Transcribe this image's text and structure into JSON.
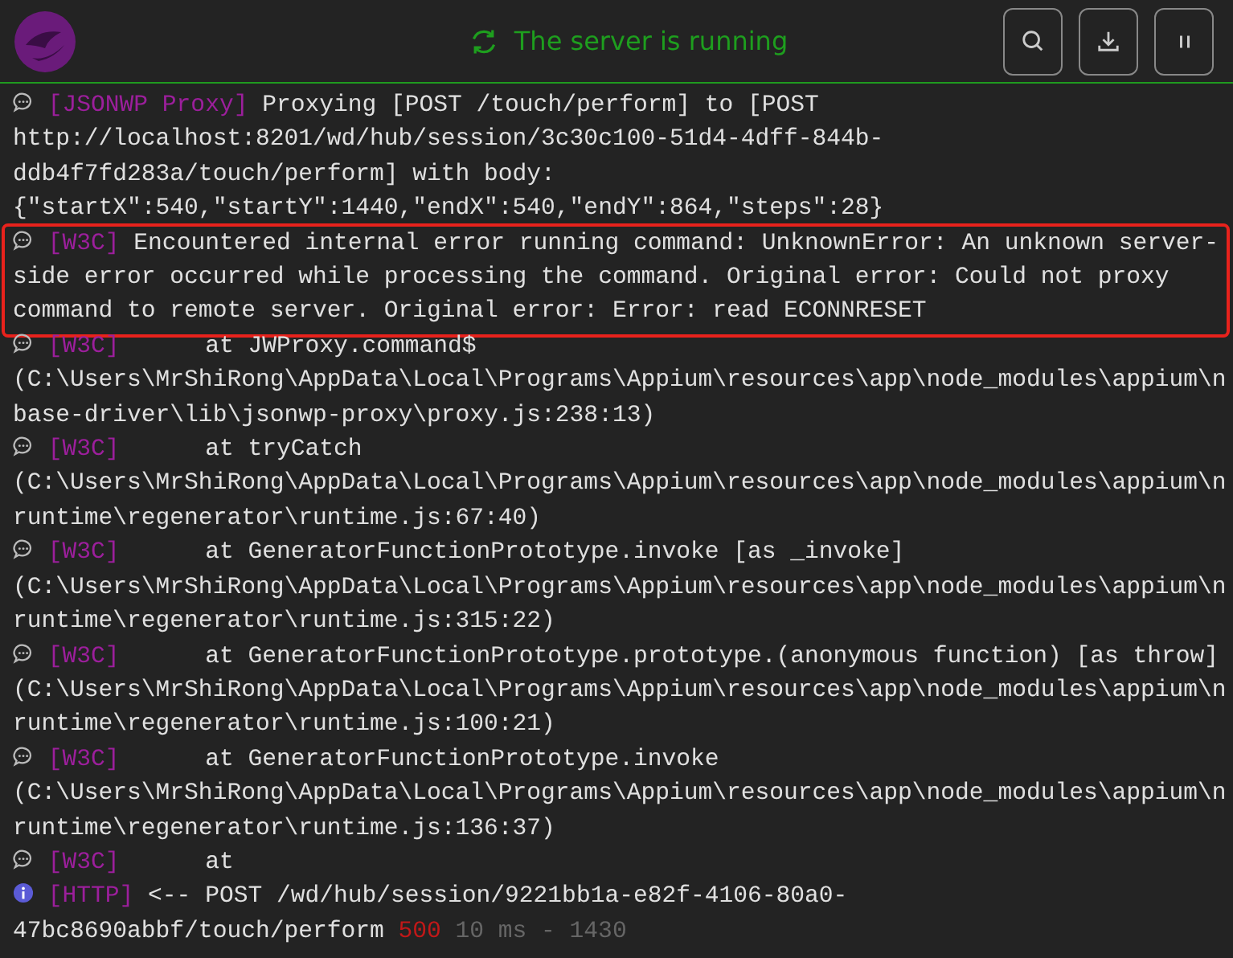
{
  "header": {
    "status": "The server is running",
    "running": true,
    "buttons": [
      {
        "kind": "search"
      },
      {
        "kind": "download"
      },
      {
        "kind": "pause"
      }
    ]
  },
  "log": [
    {
      "kind": "log",
      "tag": "[JSONWP Proxy]",
      "message": "Proxying [POST /touch/perform] to [POST http://localhost:8201/wd/hub/session/3c30c100-51d4-4dff-844b-ddb4f7fd283a/touch/perform] with body: {\"startX\":540,\"startY\":1440,\"endX\":540,\"endY\":864,\"steps\":28}",
      "highlighted": false
    },
    {
      "kind": "log",
      "tag": "[W3C]",
      "message": "Encountered internal error running command: UnknownError: An unknown server-side error occurred while processing the command. Original error: Could not proxy command to remote server. Original error: Error: read ECONNRESET",
      "highlighted": true
    },
    {
      "kind": "log",
      "tag": "[W3C]",
      "message": "     at JWProxy.command$ (C:\\Users\\MrShiRong\\AppData\\Local\\Programs\\Appium\\resources\\app\\node_modules\\appium\\nbase-driver\\lib\\jsonwp-proxy\\proxy.js:238:13)",
      "highlighted": false
    },
    {
      "kind": "log",
      "tag": "[W3C]",
      "message": "     at tryCatch (C:\\Users\\MrShiRong\\AppData\\Local\\Programs\\Appium\\resources\\app\\node_modules\\appium\\nruntime\\regenerator\\runtime.js:67:40)",
      "highlighted": false
    },
    {
      "kind": "log",
      "tag": "[W3C]",
      "message": "     at GeneratorFunctionPrototype.invoke [as _invoke] (C:\\Users\\MrShiRong\\AppData\\Local\\Programs\\Appium\\resources\\app\\node_modules\\appium\\nruntime\\regenerator\\runtime.js:315:22)",
      "highlighted": false
    },
    {
      "kind": "log",
      "tag": "[W3C]",
      "message": "     at GeneratorFunctionPrototype.prototype.(anonymous function) [as throw] (C:\\Users\\MrShiRong\\AppData\\Local\\Programs\\Appium\\resources\\app\\node_modules\\appium\\nruntime\\regenerator\\runtime.js:100:21)",
      "highlighted": false
    },
    {
      "kind": "log",
      "tag": "[W3C]",
      "message": "     at GeneratorFunctionPrototype.invoke (C:\\Users\\MrShiRong\\AppData\\Local\\Programs\\Appium\\resources\\app\\node_modules\\appium\\nruntime\\regenerator\\runtime.js:136:37)",
      "highlighted": false
    },
    {
      "kind": "log",
      "tag": "[W3C]",
      "message": "     at",
      "highlighted": false
    },
    {
      "kind": "info",
      "tag": "[HTTP]",
      "message": "<-- POST /wd/hub/session/9221bb1a-e82f-4106-80a0-47bc8690abbf/touch/perform",
      "status": "500",
      "timing": "10 ms - 1430",
      "highlighted": false
    }
  ]
}
